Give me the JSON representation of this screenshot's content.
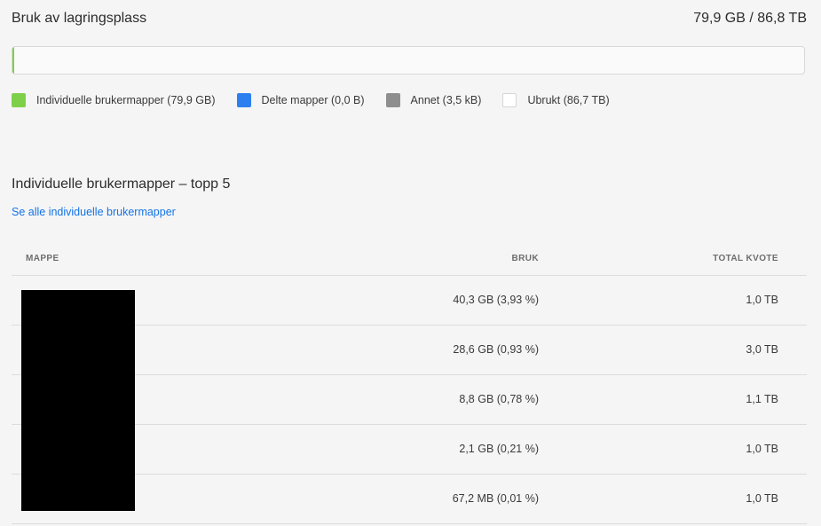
{
  "storage": {
    "title": "Bruk av lagringsplass",
    "total": "79,9 GB / 86,8 TB",
    "used_fraction": 0.0009
  },
  "legend": [
    {
      "label": "Individuelle brukermapper (79,9 GB)",
      "color": "#7ed04b",
      "icon": "green-swatch"
    },
    {
      "label": "Delte mapper (0,0 B)",
      "color": "#2d7ff0",
      "icon": "blue-swatch"
    },
    {
      "label": "Annet (3,5 kB)",
      "color": "#8e8e8e",
      "icon": "gray-swatch"
    },
    {
      "label": "Ubrukt (86,7 TB)",
      "color": "#ffffff",
      "icon": "white-swatch"
    }
  ],
  "section": {
    "title": "Individuelle brukermapper – topp 5",
    "see_all_link": "Se alle individuelle brukermapper"
  },
  "table": {
    "headers": {
      "folder": "MAPPE",
      "usage": "BRUK",
      "quota": "TOTAL KVOTE"
    },
    "rows": [
      {
        "usage": "40,3 GB (3,93 %)",
        "quota": "1,0 TB"
      },
      {
        "usage": "28,6 GB (0,93 %)",
        "quota": "3,0 TB"
      },
      {
        "usage": "8,8 GB (0,78 %)",
        "quota": "1,1 TB"
      },
      {
        "usage": "2,1 GB (0,21 %)",
        "quota": "1,0 TB"
      },
      {
        "usage": "67,2 MB (0,01 %)",
        "quota": "1,0 TB"
      }
    ]
  }
}
